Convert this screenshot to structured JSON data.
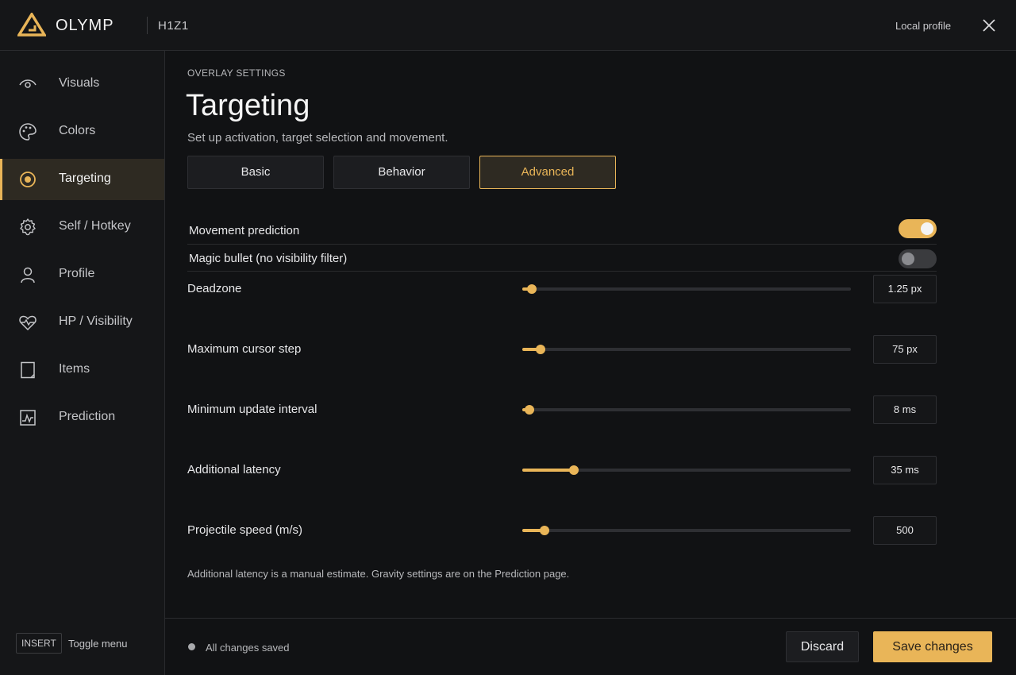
{
  "header": {
    "brand": "OLYMP",
    "game": "H1Z1",
    "profile_label": "Local profile"
  },
  "sidebar": {
    "items": [
      {
        "label": "Visuals",
        "icon": "eye-icon",
        "active": false
      },
      {
        "label": "Colors",
        "icon": "palette-icon",
        "active": false
      },
      {
        "label": "Targeting",
        "icon": "target-icon",
        "active": true
      },
      {
        "label": "Self / Hotkey",
        "icon": "gear-icon",
        "active": false
      },
      {
        "label": "Profile",
        "icon": "user-icon",
        "active": false
      },
      {
        "label": "HP / Visibility",
        "icon": "heart-pulse-icon",
        "active": false
      },
      {
        "label": "Items",
        "icon": "item-icon",
        "active": false
      },
      {
        "label": "Prediction",
        "icon": "chart-icon",
        "active": false
      }
    ],
    "hotkey": {
      "key": "INSERT",
      "label": "Toggle menu"
    }
  },
  "main": {
    "eyebrow": "OVERLAY SETTINGS",
    "title": "Targeting",
    "subtitle": "Set up activation, target selection and movement.",
    "tabs": [
      {
        "label": "Basic",
        "active": false
      },
      {
        "label": "Behavior",
        "active": false
      },
      {
        "label": "Advanced",
        "active": true
      }
    ],
    "toggles": [
      {
        "label": "Movement prediction",
        "on": true
      },
      {
        "label": "Magic bullet (no visibility filter)",
        "on": false
      }
    ],
    "sliders": [
      {
        "label": "Deadzone",
        "value": "1.25 px",
        "fraction": 0.015
      },
      {
        "label": "Maximum cursor step",
        "value": "75 px",
        "fraction": 0.04
      },
      {
        "label": "Minimum update interval",
        "value": "8 ms",
        "fraction": 0.008
      },
      {
        "label": "Additional latency",
        "value": "35 ms",
        "fraction": 0.143
      },
      {
        "label": "Projectile speed (m/s)",
        "value": "500",
        "fraction": 0.052
      }
    ],
    "footnote": "Additional latency is a manual estimate. Gravity settings are on the Prediction page."
  },
  "footer": {
    "status": "All changes saved",
    "discard_label": "Discard",
    "save_label": "Save changes"
  },
  "colors": {
    "accent": "#e9b558",
    "background": "#111214",
    "panel": "#151618"
  }
}
